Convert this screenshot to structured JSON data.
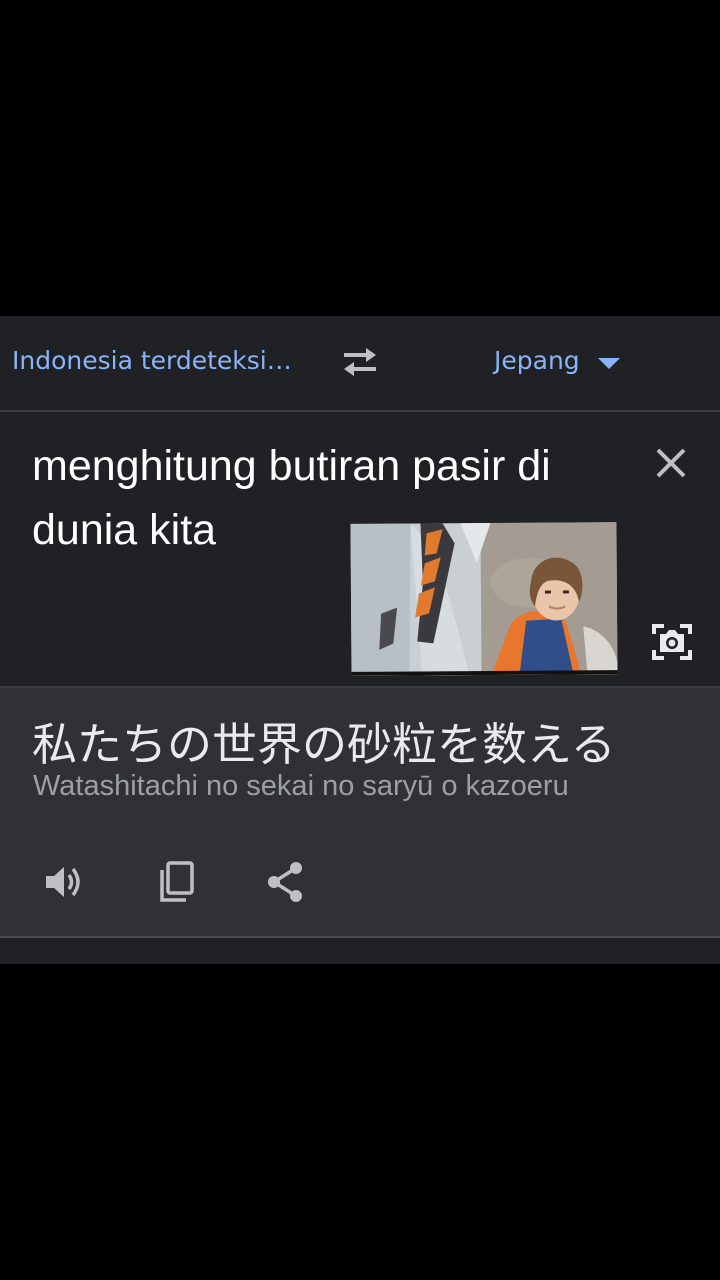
{
  "lang_bar": {
    "source_language": "Indonesia terdeteksi…",
    "target_language": "Jepang"
  },
  "input": {
    "text": "menghitung butiran pasir di dunia kita"
  },
  "output": {
    "translation": "私たちの世界の砂粒を数える",
    "romanization": "Watashitachi no sekai no saryū o kazoeru"
  },
  "icons": {
    "swap": "swap-icon",
    "clear": "close-icon",
    "camera": "camera-search-icon",
    "speaker": "speaker-icon",
    "copy": "copy-icon",
    "share": "share-icon"
  },
  "colors": {
    "background": "#202124",
    "output_background": "#303134",
    "accent": "#8ab4f8",
    "text": "#ffffff",
    "secondary_text": "#9aa0a6"
  }
}
